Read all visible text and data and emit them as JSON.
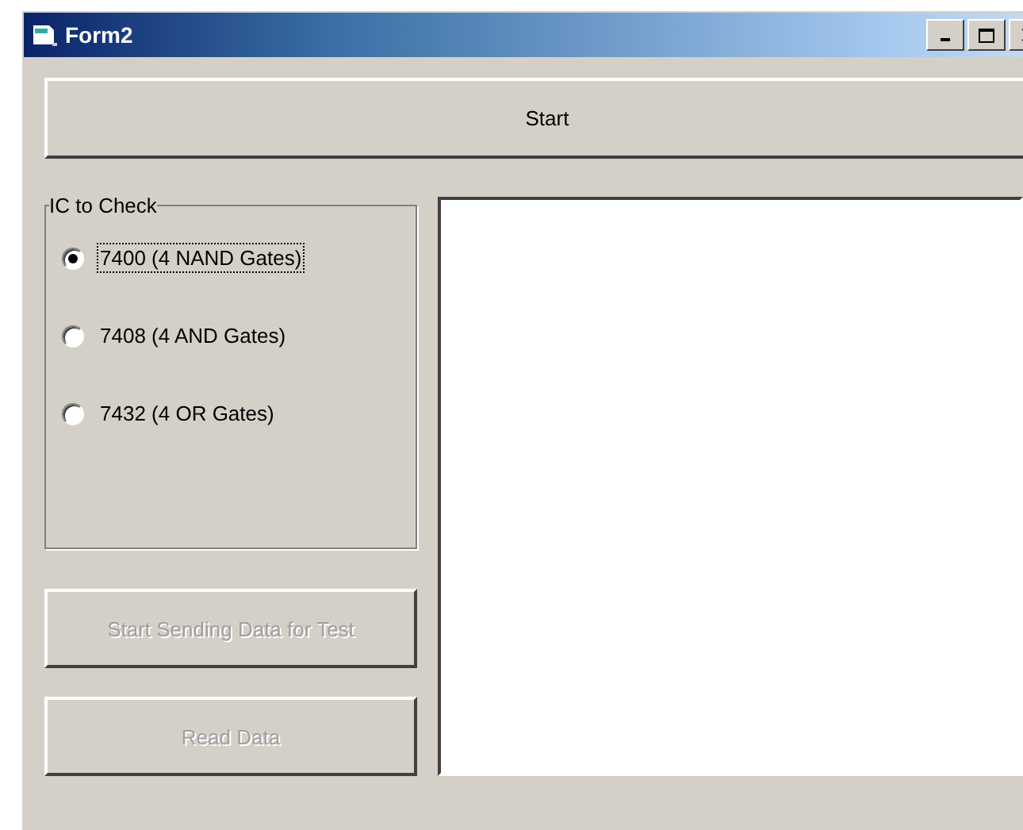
{
  "window": {
    "title": "Form2"
  },
  "start_button": {
    "label": "Start",
    "disabled": false
  },
  "group": {
    "title": "IC to Check",
    "options": [
      {
        "label": "7400 (4 NAND Gates)",
        "selected": true
      },
      {
        "label": "7408 (4 AND Gates)",
        "selected": false
      },
      {
        "label": "7432 (4 OR Gates)",
        "selected": false
      }
    ]
  },
  "buttons": [
    {
      "label": "Start Sending Data for Test",
      "disabled": true
    },
    {
      "label": "Read Data",
      "disabled": true
    }
  ]
}
